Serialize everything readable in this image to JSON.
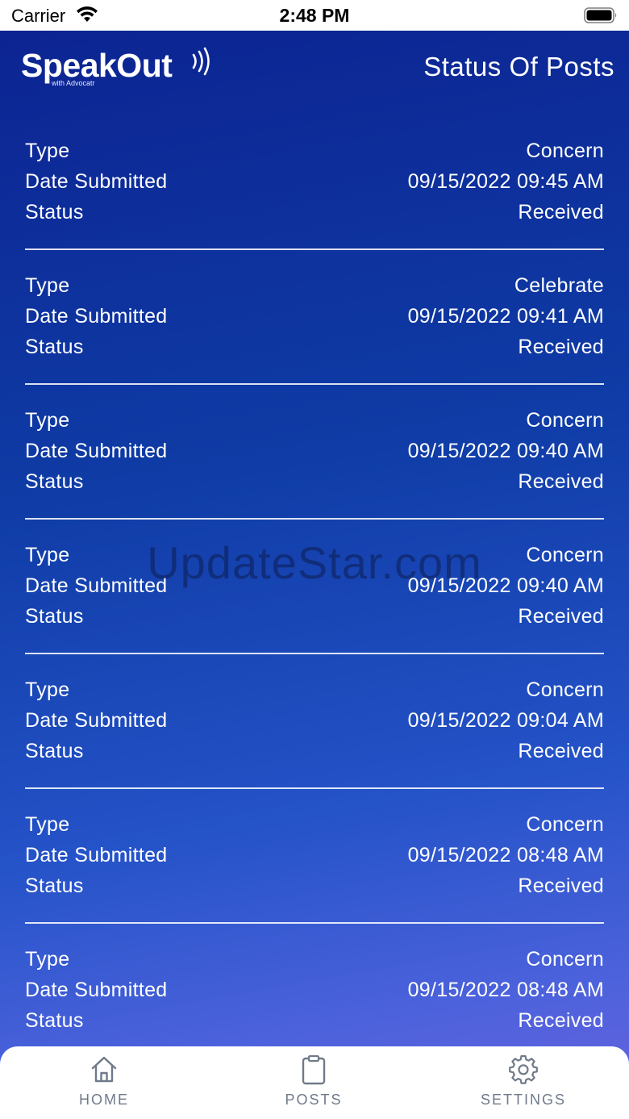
{
  "status_bar": {
    "carrier": "Carrier",
    "time": "2:48 PM"
  },
  "header": {
    "logo_text": "SpeakOut",
    "logo_subtitle": "with Advocatr",
    "title": "Status Of Posts"
  },
  "posts": [
    {
      "type_label": "Type",
      "type": "Concern",
      "date_label": "Date Submitted",
      "date": "09/15/2022 09:45 AM",
      "status_label": "Status",
      "status": "Received"
    },
    {
      "type_label": "Type",
      "type": "Celebrate",
      "date_label": "Date Submitted",
      "date": "09/15/2022 09:41 AM",
      "status_label": "Status",
      "status": "Received"
    },
    {
      "type_label": "Type",
      "type": "Concern",
      "date_label": "Date Submitted",
      "date": "09/15/2022 09:40 AM",
      "status_label": "Status",
      "status": "Received"
    },
    {
      "type_label": "Type",
      "type": "Concern",
      "date_label": "Date Submitted",
      "date": "09/15/2022 09:40 AM",
      "status_label": "Status",
      "status": "Received"
    },
    {
      "type_label": "Type",
      "type": "Concern",
      "date_label": "Date Submitted",
      "date": "09/15/2022 09:04 AM",
      "status_label": "Status",
      "status": "Received"
    },
    {
      "type_label": "Type",
      "type": "Concern",
      "date_label": "Date Submitted",
      "date": "09/15/2022 08:48 AM",
      "status_label": "Status",
      "status": "Received"
    },
    {
      "type_label": "Type",
      "type": "Concern",
      "date_label": "Date Submitted",
      "date": "09/15/2022 08:48 AM",
      "status_label": "Status",
      "status": "Received"
    }
  ],
  "watermark": "UpdateStar.com",
  "tabs": [
    {
      "label": "HOME",
      "icon": "home-icon"
    },
    {
      "label": "POSTS",
      "icon": "clipboard-icon"
    },
    {
      "label": "SETTINGS",
      "icon": "gear-icon"
    }
  ]
}
